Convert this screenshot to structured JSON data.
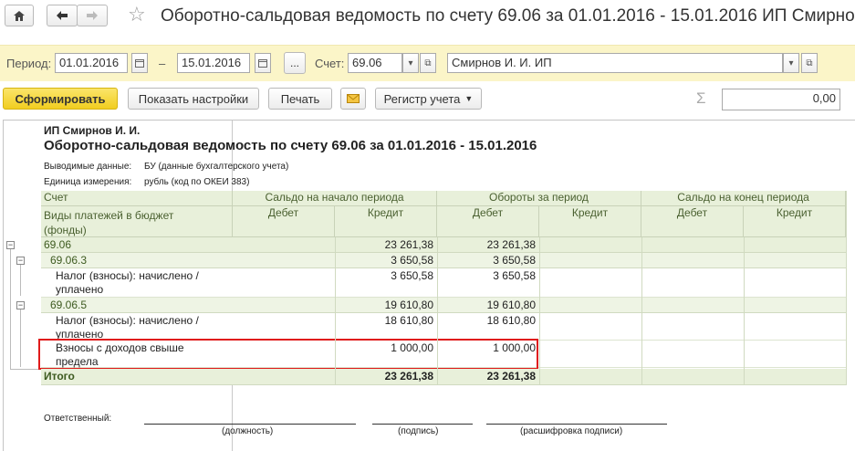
{
  "window": {
    "title": "Оборотно-сальдовая ведомость по счету 69.06 за 01.01.2016 - 15.01.2016 ИП Смирно"
  },
  "params": {
    "period_label": "Период:",
    "date_from": "01.01.2016",
    "dash": "–",
    "date_to": "15.01.2016",
    "ellipsis": "...",
    "account_label": "Счет:",
    "account": "69.06",
    "organization": "Смирнов И. И. ИП"
  },
  "toolbar": {
    "generate": "Сформировать",
    "show_settings": "Показать настройки",
    "print": "Печать",
    "register": "Регистр учета",
    "sigma": "Σ",
    "sum_value": "0,00"
  },
  "report": {
    "org": "ИП Смирнов И. И.",
    "title": "Оборотно-сальдовая ведомость по счету 69.06 за 01.01.2016 - 15.01.2016",
    "output_label": "Выводимые данные:",
    "output_value": "БУ (данные бухгалтерского учета)",
    "unit_label": "Единица измерения:",
    "unit_value": "рубль (код по ОКЕИ 383)",
    "col_account": "Счет",
    "col_subkonto_1": "Виды платежей в бюджет",
    "col_subkonto_2": "(фонды)",
    "col_start": "Сальдо на начало периода",
    "col_turnover": "Обороты за период",
    "col_end": "Сальдо на конец периода",
    "debit": "Дебет",
    "credit": "Кредит",
    "rows": [
      {
        "name": "69.06",
        "start_credit": "23 261,38",
        "turn_debit": "23 261,38"
      },
      {
        "name": "69.06.3",
        "start_credit": "3 650,58",
        "turn_debit": "3 650,58"
      },
      {
        "name": "Налог (взносы): начислено /",
        "name2": "уплачено",
        "start_credit": "3 650,58",
        "turn_debit": "3 650,58"
      },
      {
        "name": "69.06.5",
        "start_credit": "19 610,80",
        "turn_debit": "19 610,80"
      },
      {
        "name": "Налог (взносы): начислено /",
        "name2": "уплачено",
        "start_credit": "18 610,80",
        "turn_debit": "18 610,80"
      },
      {
        "name": "Взносы с доходов свыше",
        "name2": "предела",
        "start_credit": "1 000,00",
        "turn_debit": "1 000,00"
      }
    ],
    "total_label": "Итого",
    "total_start_credit": "23 261,38",
    "total_turn_debit": "23 261,38",
    "responsible": "Ответственный:",
    "sign_position": "(должность)",
    "sign_signature": "(подпись)",
    "sign_decoding": "(расшифровка подписи)",
    "tree_minus": "⊟"
  }
}
